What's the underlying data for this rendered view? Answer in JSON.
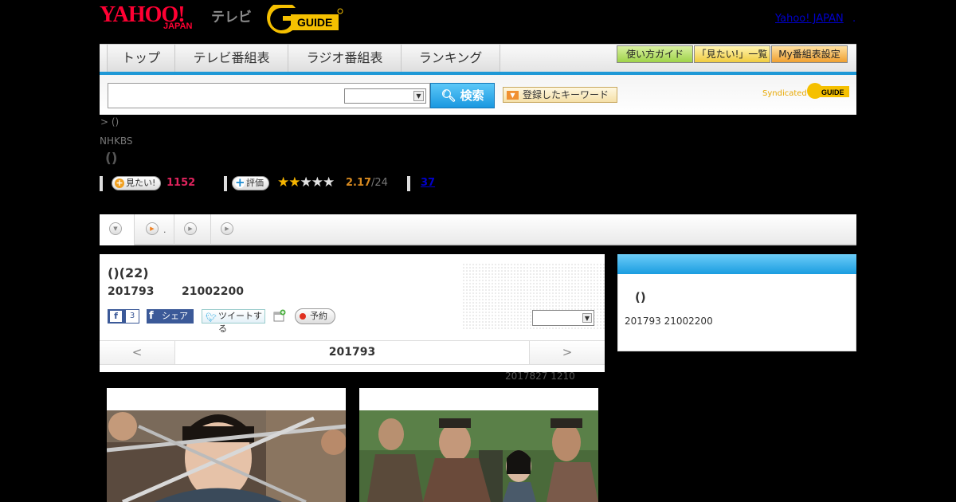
{
  "header": {
    "logo_yahoo": "YAHOO!",
    "logo_japan": "JAPAN",
    "logo_tv": "テレビ",
    "yahoo_japan_link": "Yahoo! JAPAN",
    "link_dot": "."
  },
  "nav": {
    "items": [
      "トップ",
      "テレビ番組表",
      "ラジオ番組表",
      "ランキング"
    ],
    "utility": [
      "使い方ガイド",
      "「見たい!」一覧",
      "My番組表設定"
    ]
  },
  "search": {
    "query": "",
    "select_value": "",
    "button_label": "検索",
    "keyword_button": "登録したキーワード",
    "syndicated": "Syndicated"
  },
  "breadcrumb": ">  ()",
  "program": {
    "station": "NHKBS",
    "title": "()",
    "want_label": "見たい!",
    "want_count": "1152",
    "rate_label": "評価",
    "rating": 2.17,
    "rating_text": "2.17",
    "rating_count": "/24",
    "review_count": "37"
  },
  "tabs": [
    "",
    ".",
    ""
  ],
  "episode": {
    "title": "()(22)",
    "date": "201793",
    "time": "21002200",
    "fb_like_count": "3",
    "fb_share": "シェア",
    "tweet": "ツイートする",
    "reserve": "予約",
    "select_value": "",
    "nav_prev": "<",
    "nav_date": "201793",
    "nav_next": ">",
    "updated": "2017827  1210"
  },
  "side": {
    "title": "()",
    "date": "201793  21002200"
  },
  "colors": {
    "accent_blue": "#1e98d6",
    "yahoo_red": "#ff0033",
    "want_pink": "#e0245e",
    "star_gold": "#f5b400"
  }
}
